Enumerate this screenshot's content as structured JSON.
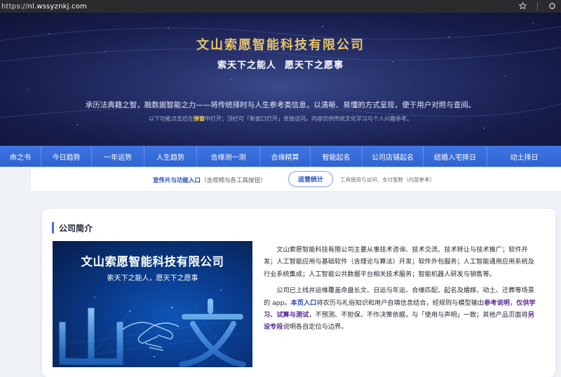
{
  "browser": {
    "url_scheme": "https://",
    "url_host": "nl.wssyznkj.com"
  },
  "hero": {
    "company_name": "文山索愿智能科技有限公司",
    "slogan_left": "索天下之能人",
    "slogan_right": "愿天下之愿事",
    "intro": "承历法典籍之智，融数据智能之力——将传统择时与人生参考类信息，以清晰、易懂的方式呈现，便于用户对照与查阅。",
    "note_before": "以下功能点击后在",
    "note_highlight": "弹窗",
    "note_after": "中打开；顶栏可「新窗口打开」单独访问。内容仅供传统文化学习与个人兴趣参考。"
  },
  "nav": {
    "items": [
      {
        "label": "命之书"
      },
      {
        "label": "今日趋势"
      },
      {
        "label": "一年运势"
      },
      {
        "label": "人生趋势"
      },
      {
        "label": "合缘测一测"
      },
      {
        "label": "合缘精算"
      },
      {
        "label": "智能起名"
      },
      {
        "label": "公司店铺起名"
      },
      {
        "label": "结婚入宅择日"
      },
      {
        "label": "动土择日"
      }
    ]
  },
  "subbar": {
    "promo_label": "宣传片与功能入口",
    "promo_paren": "（含视频与各工具按钮）",
    "stats_button": "运营统计",
    "stats_note": "工具使用与访问、支付笔数（内部参考）"
  },
  "profile": {
    "title": "公司简介",
    "banner_title": "文山索愿智能科技有限公司",
    "banner_slogan": "索天下之能人，愿天下之愿事",
    "p1": "文山索愿智能科技有限公司主要从事技术咨询、技术交流、技术转让与技术推广；软件开发；人工智能应用与基础软件（含理论与算法）开发；软件外包服务；人工智能通用应用系统及行业系统集成；人工智能公共数据平台相关技术服务；智能机器人研发与销售等。",
    "p2_a": "公司已上线并运维覆盖命盘长文、日运与年运、合缘匹配、起名及婚嫁、动土、迁葬等场景的 app。",
    "p2_b": "本页入口",
    "p2_c": "将农历与礼俗知识和用户自填信息结合，经规则与模型输出",
    "p2_d": "参考说明",
    "p2_e": "，",
    "p2_f": "仅供学习、试算与测试",
    "p2_g": "，不预测、不担保、不作决策依据，与「使用与声明」一致；其他产品页面将",
    "p2_h": "另设专段",
    "p2_i": "说明各自定位与边界。"
  }
}
